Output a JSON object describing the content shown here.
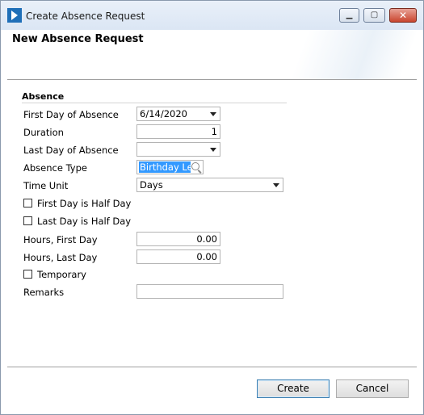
{
  "window": {
    "title": "Create Absence Request",
    "icon": "app-chevron-icon"
  },
  "header": {
    "title": "New Absence Request"
  },
  "section": {
    "title": "Absence"
  },
  "fields": {
    "first_day": {
      "label": "First Day of Absence",
      "value": "6/14/2020"
    },
    "duration": {
      "label": "Duration",
      "value": "1"
    },
    "last_day": {
      "label": "Last Day of Absence",
      "value": ""
    },
    "absence_type": {
      "label": "Absence Type",
      "value": "Birthday Le"
    },
    "time_unit": {
      "label": "Time Unit",
      "value": "Days"
    },
    "first_half": {
      "label": "First Day is Half Day",
      "checked": false
    },
    "last_half": {
      "label": "Last Day is Half Day",
      "checked": false
    },
    "hours_first": {
      "label": "Hours, First Day",
      "value": "0.00"
    },
    "hours_last": {
      "label": "Hours, Last Day",
      "value": "0.00"
    },
    "temporary": {
      "label": "Temporary",
      "checked": false
    },
    "remarks": {
      "label": "Remarks",
      "value": ""
    }
  },
  "buttons": {
    "create": "Create",
    "cancel": "Cancel"
  },
  "colors": {
    "selection": "#3399ff",
    "close_button": "#c9452e",
    "primary_border": "#3c7fb1"
  }
}
